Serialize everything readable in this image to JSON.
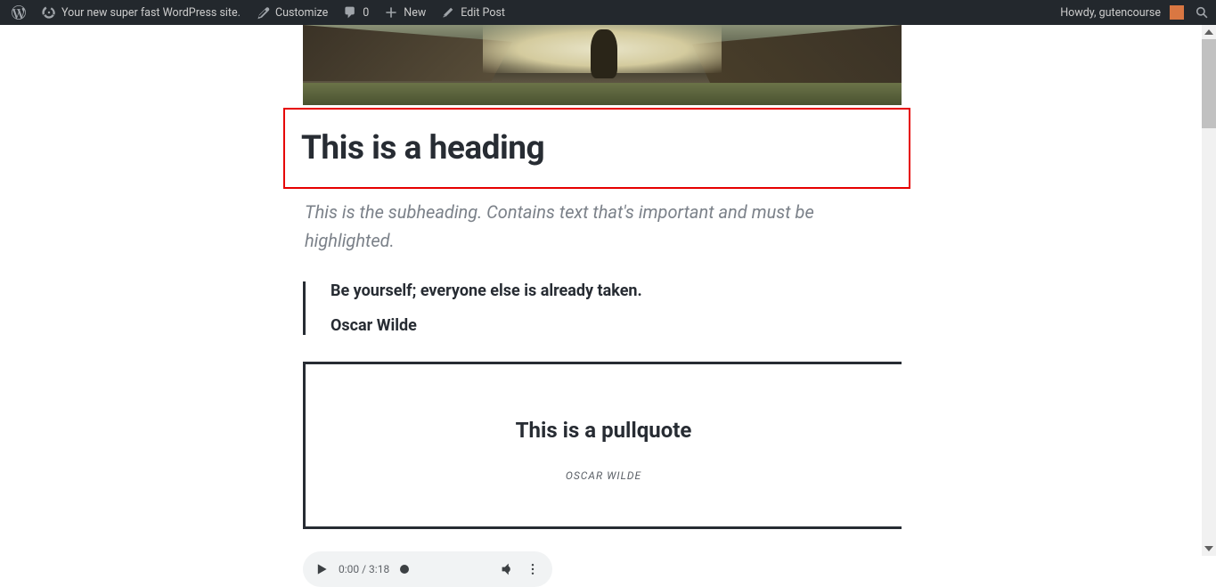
{
  "adminbar": {
    "site_name": "Your new super fast WordPress site.",
    "customize": "Customize",
    "comments_count": "0",
    "new": "New",
    "edit_post": "Edit Post",
    "howdy": "Howdy, gutencourse"
  },
  "content": {
    "heading": "This is a heading",
    "subheading": "This is the subheading. Contains text that's important and must be highlighted.",
    "blockquote": {
      "text": "Be yourself; everyone else is already taken.",
      "author": "Oscar Wilde"
    },
    "pullquote": {
      "text": "This is a pullquote",
      "author": "OSCAR WILDE"
    },
    "audio": {
      "time": "0:00 / 3:18"
    }
  }
}
